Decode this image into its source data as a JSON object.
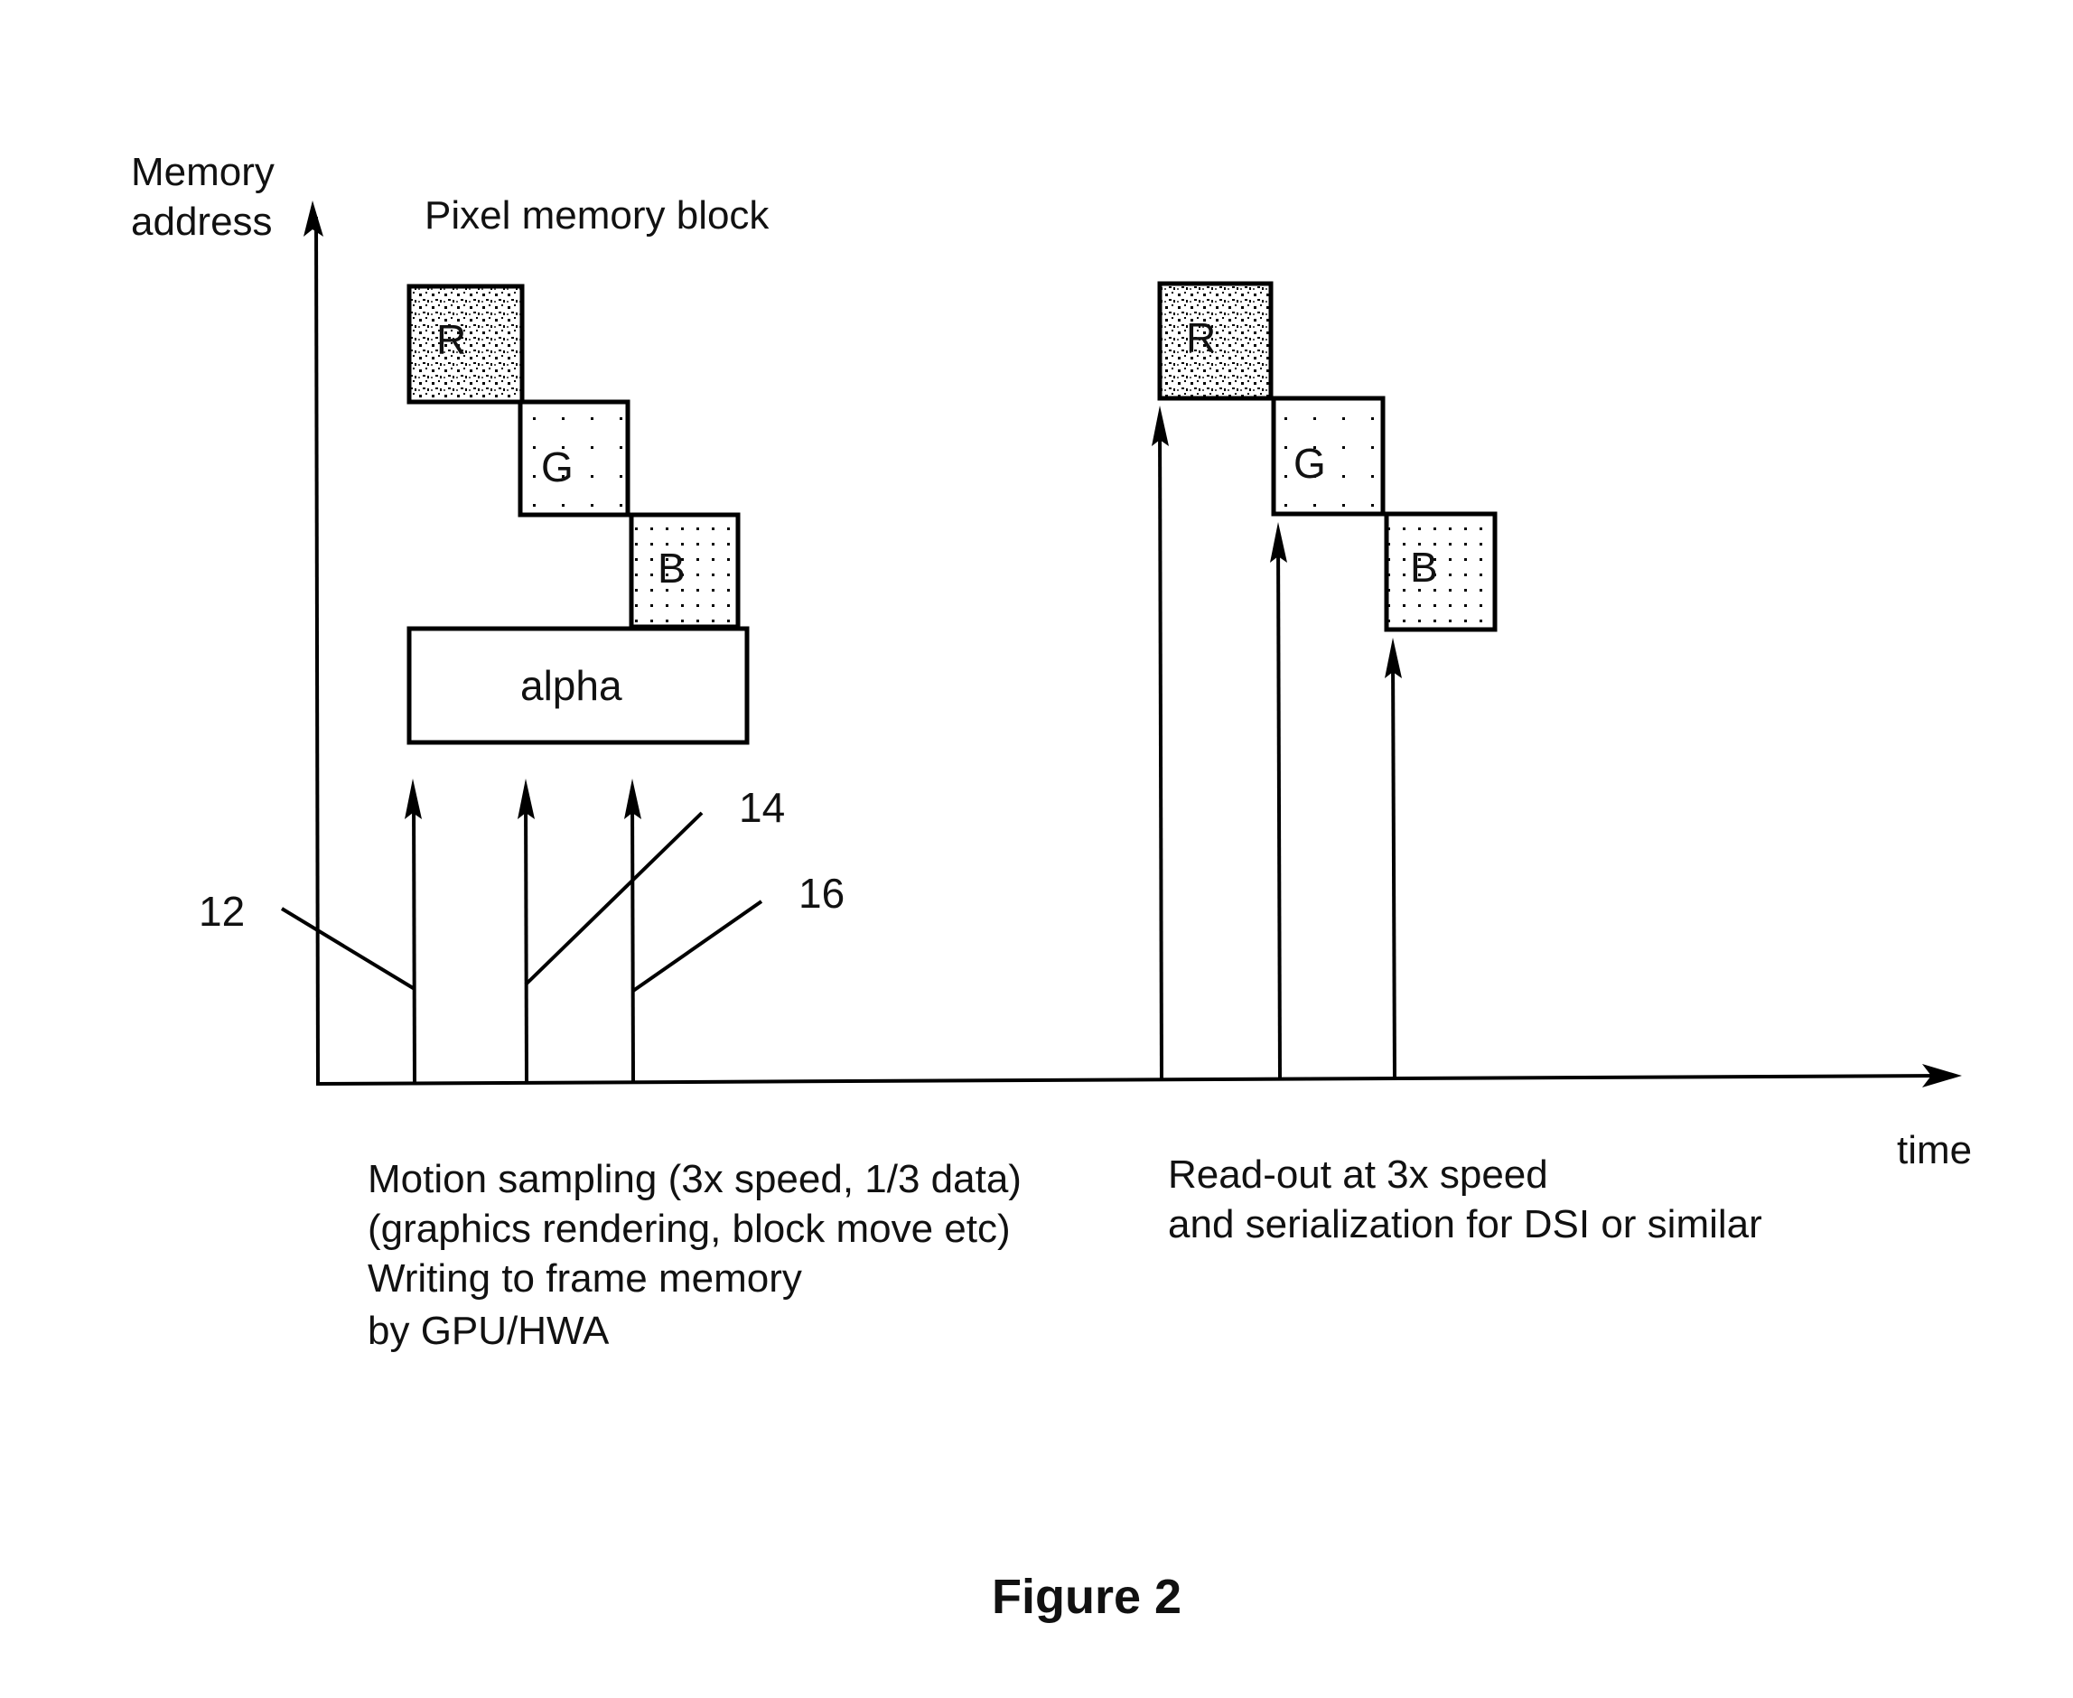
{
  "axes": {
    "y_label_lines": [
      "Memory",
      "address"
    ],
    "x_label": "time"
  },
  "title": "Pixel memory block",
  "left_block": {
    "components": [
      {
        "label": "R",
        "fill": "dense-dots"
      },
      {
        "label": "G",
        "fill": "sparse-dots"
      },
      {
        "label": "B",
        "fill": "medium-dots"
      },
      {
        "label": "alpha",
        "fill": "none"
      }
    ]
  },
  "right_block": {
    "components": [
      {
        "label": "R",
        "fill": "dense-dots"
      },
      {
        "label": "G",
        "fill": "sparse-dots"
      },
      {
        "label": "B",
        "fill": "medium-dots"
      }
    ]
  },
  "reference_numerals": [
    "12",
    "14",
    "16"
  ],
  "captions": {
    "left": [
      "Motion sampling (3x speed, 1/3 data)",
      "(graphics rendering, block move etc)",
      "Writing to frame memory",
      "by GPU/HWA"
    ],
    "right": [
      "Read-out at 3x speed",
      "and serialization for DSI or similar"
    ]
  },
  "figure_label": "Figure 2"
}
